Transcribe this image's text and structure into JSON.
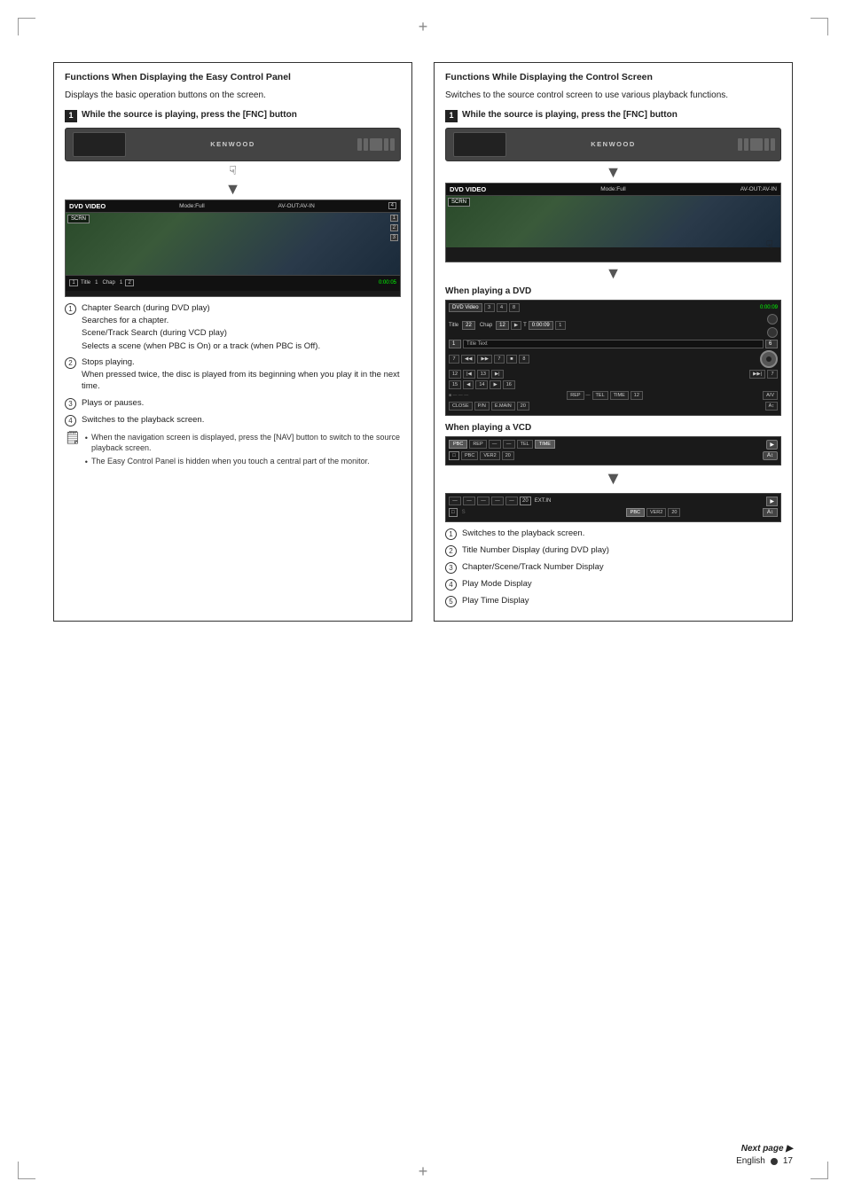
{
  "page": {
    "language": "English",
    "page_number": "17",
    "next_page_label": "Next page ▶"
  },
  "left_section": {
    "title": "Functions When Displaying the Easy Control Panel",
    "description": "Displays the basic operation buttons on the screen.",
    "step1_label": "While the source is playing, press the [FNC] button",
    "items": [
      {
        "num": "1",
        "main": "Chapter Search (during DVD play)",
        "subs": [
          "Searches for a chapter.",
          "Scene/Track Search (during VCD play)",
          "Selects a scene (when PBC is On) or a track (when PBC is Off)."
        ]
      },
      {
        "num": "2",
        "main": "Stops playing.",
        "subs": [
          "When pressed twice, the disc is played from its beginning when you play it in the next time."
        ]
      },
      {
        "num": "3",
        "main": "Plays or pauses."
      },
      {
        "num": "4",
        "main": "Switches to the playback screen."
      }
    ],
    "notes": [
      "When the navigation screen is displayed, press the [NAV] button to switch to the source playback screen.",
      "The Easy Control Panel is hidden when you touch a central part of the monitor."
    ]
  },
  "right_section": {
    "title": "Functions While Displaying the Control Screen",
    "description": "Switches to the source control screen to use various playback functions.",
    "step1_label": "While the source is playing, press the [FNC] button",
    "dvd_label": "When playing a DVD",
    "vcd_label": "When playing a VCD",
    "dvd_screen": {
      "header_left": "DVD Video",
      "header_mid": "3",
      "header_right": "8",
      "title_num": "22",
      "chap_num": "12",
      "time": "0:00:09",
      "title_text": "Title Text",
      "num_1": "1",
      "num_6": "6"
    },
    "items": [
      {
        "num": "1",
        "text": "Switches to the playback screen."
      },
      {
        "num": "2",
        "text": "Title Number Display (during DVD play)"
      },
      {
        "num": "3",
        "text": "Chapter/Scene/Track Number Display"
      },
      {
        "num": "4",
        "text": "Play Mode Display"
      },
      {
        "num": "5",
        "text": "Play Time Display"
      }
    ]
  },
  "device_screen": {
    "mode_full": "Mode:Full",
    "av_out": "AV-OUT:AV-IN",
    "dvd_video": "DVD VIDEO",
    "scrn": "SCRN",
    "title": "Title",
    "chap": "Chap",
    "t_label": "T",
    "time_val": "0:00:05"
  }
}
